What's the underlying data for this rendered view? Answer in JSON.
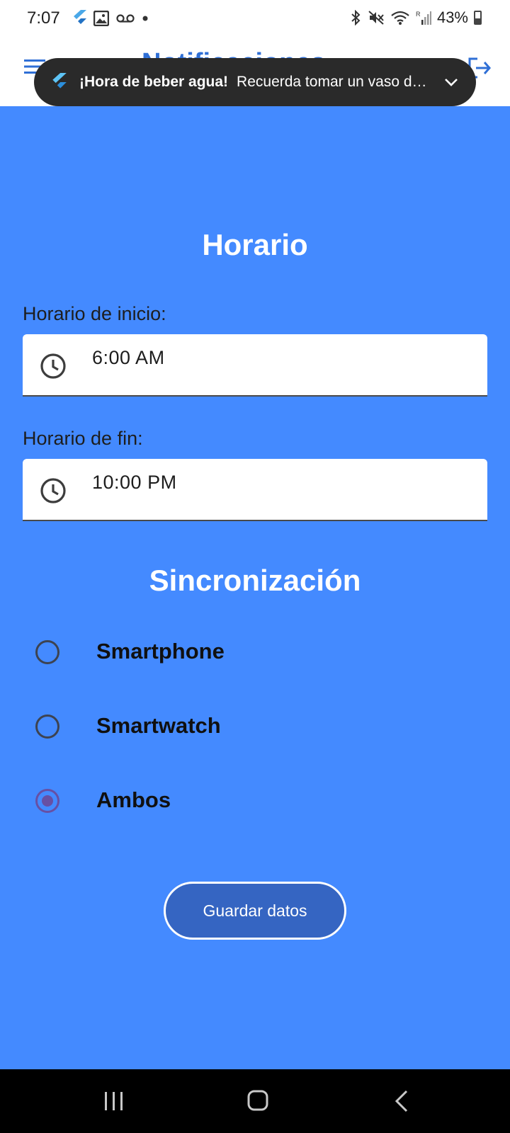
{
  "status_bar": {
    "time": "7:07",
    "battery": "43%"
  },
  "app_bar": {
    "title": "Notificaciones"
  },
  "notification": {
    "title": "¡Hora de beber agua!",
    "text": "Recuerda tomar un vaso de agua"
  },
  "schedule": {
    "title": "Horario",
    "start_label": "Horario de inicio:",
    "start_value": "6:00 AM",
    "end_label": "Horario de fin:",
    "end_value": "10:00 PM"
  },
  "sync": {
    "title": "Sincronización",
    "options": [
      {
        "label": "Smartphone",
        "selected": false
      },
      {
        "label": "Smartwatch",
        "selected": false
      },
      {
        "label": "Ambos",
        "selected": true
      }
    ]
  },
  "actions": {
    "save_label": "Guardar datos"
  },
  "colors": {
    "background": "#448aff",
    "button": "#3565c2",
    "radio_selected": "#6750a4"
  }
}
